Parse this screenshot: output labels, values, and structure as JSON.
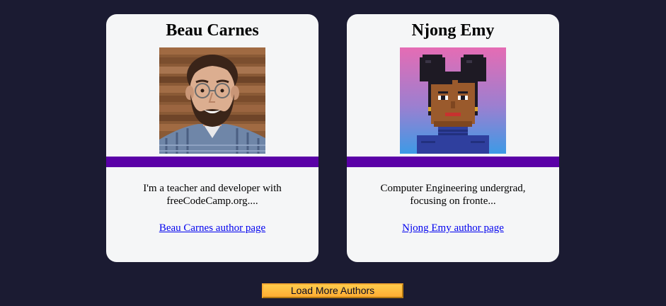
{
  "authors": [
    {
      "name": "Beau Carnes",
      "bio_line1": "I'm a teacher and developer with",
      "bio_line2": "freeCodeCamp.org....",
      "link_text": "Beau Carnes author page"
    },
    {
      "name": "Njong Emy",
      "bio_line1": "Computer Engineering undergrad,",
      "bio_line2": "focusing on fronte...",
      "link_text": "Njong Emy author page"
    }
  ],
  "load_more_label": "Load More Authors",
  "colors": {
    "page_background": "#1b1b32",
    "card_background": "#f5f6f7",
    "divider": "#5a01a7",
    "button": "#feac32",
    "link": "#0000ee"
  }
}
